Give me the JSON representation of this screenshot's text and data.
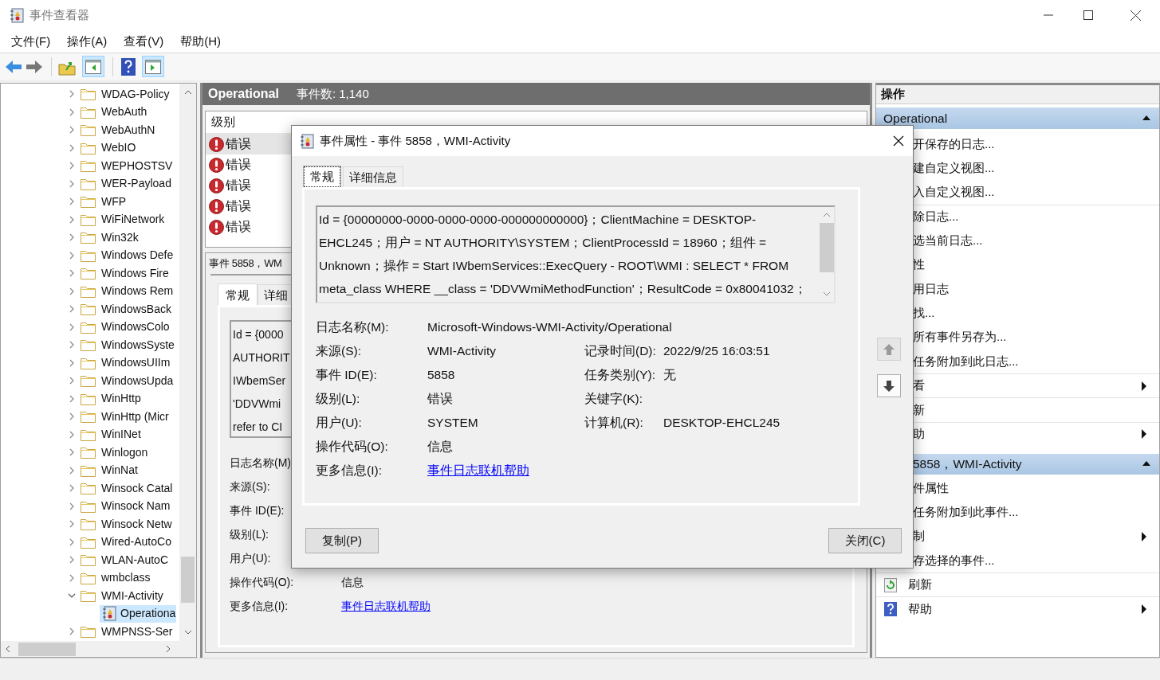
{
  "window": {
    "title": "事件查看器"
  },
  "menu": [
    "文件(F)",
    "操作(A)",
    "查看(V)",
    "帮助(H)"
  ],
  "tree": [
    {
      "label": "WDAG-Policy",
      "expanded": false,
      "selected": false
    },
    {
      "label": "WebAuth",
      "expanded": false,
      "selected": false
    },
    {
      "label": "WebAuthN",
      "expanded": false,
      "selected": false
    },
    {
      "label": "WebIO",
      "expanded": false,
      "selected": false
    },
    {
      "label": "WEPHOSTSV",
      "expanded": false,
      "selected": false
    },
    {
      "label": "WER-Payload",
      "expanded": false,
      "selected": false
    },
    {
      "label": "WFP",
      "expanded": false,
      "selected": false
    },
    {
      "label": "WiFiNetwork",
      "expanded": false,
      "selected": false
    },
    {
      "label": "Win32k",
      "expanded": false,
      "selected": false
    },
    {
      "label": "Windows Defe",
      "expanded": false,
      "selected": false
    },
    {
      "label": "Windows Fire",
      "expanded": false,
      "selected": false
    },
    {
      "label": "Windows Rem",
      "expanded": false,
      "selected": false
    },
    {
      "label": "WindowsBack",
      "expanded": false,
      "selected": false
    },
    {
      "label": "WindowsColo",
      "expanded": false,
      "selected": false
    },
    {
      "label": "WindowsSyste",
      "expanded": false,
      "selected": false
    },
    {
      "label": "WindowsUIIm",
      "expanded": false,
      "selected": false
    },
    {
      "label": "WindowsUpda",
      "expanded": false,
      "selected": false
    },
    {
      "label": "WinHttp",
      "expanded": false,
      "selected": false
    },
    {
      "label": "WinHttp (Micr",
      "expanded": false,
      "selected": false
    },
    {
      "label": "WinINet",
      "expanded": false,
      "selected": false
    },
    {
      "label": "Winlogon",
      "expanded": false,
      "selected": false
    },
    {
      "label": "WinNat",
      "expanded": false,
      "selected": false
    },
    {
      "label": "Winsock Catal",
      "expanded": false,
      "selected": false
    },
    {
      "label": "Winsock Nam",
      "expanded": false,
      "selected": false
    },
    {
      "label": "Winsock Netw",
      "expanded": false,
      "selected": false
    },
    {
      "label": "Wired-AutoCo",
      "expanded": false,
      "selected": false
    },
    {
      "label": "WLAN-AutoC",
      "expanded": false,
      "selected": false
    },
    {
      "label": "wmbclass",
      "expanded": false,
      "selected": false
    },
    {
      "label": "WMI-Activity",
      "expanded": true,
      "selected": false,
      "children": [
        {
          "label": "Operationa",
          "selected": true
        }
      ]
    },
    {
      "label": "WMPNSS-Ser",
      "expanded": false,
      "selected": false
    }
  ],
  "log": {
    "title": "Operational",
    "count": "事件数: 1,140",
    "column": "级别",
    "rows": [
      {
        "level": "错误",
        "selected": true
      },
      {
        "level": "错误",
        "selected": false
      },
      {
        "level": "错误",
        "selected": false
      },
      {
        "level": "错误",
        "selected": false
      },
      {
        "level": "错误",
        "selected": false
      }
    ]
  },
  "preview": {
    "title": "事件 5858，WM",
    "tabs": [
      {
        "label": "常规",
        "selected": true
      },
      {
        "label": "详细",
        "selected": false
      }
    ],
    "lines": [
      "Id = {0000",
      "AUTHORIT",
      "IWbemSer",
      "'DDVWmi",
      "refer to CI"
    ],
    "fields": [
      {
        "label": "日志名称(M)"
      },
      {
        "label": "来源(S):"
      },
      {
        "label": "事件 ID(E):"
      },
      {
        "label": "级别(L):"
      },
      {
        "label": "用户(U):"
      },
      {
        "label": "操作代码(O):",
        "value": "信息"
      },
      {
        "label": "更多信息(I):",
        "value": "事件日志联机帮助",
        "kind": "link"
      }
    ]
  },
  "dialog": {
    "title": "事件属性 - 事件 5858，WMI-Activity",
    "tabs": [
      {
        "label": "常规",
        "selected": true
      },
      {
        "label": "详细信息",
        "selected": false
      }
    ],
    "lines": [
      "Id = {00000000-0000-0000-0000-000000000000}；ClientMachine = DESKTOP-",
      "EHCL245；用户 = NT AUTHORITY\\SYSTEM；ClientProcessId = 18960；组件 =",
      "Unknown；操作 = Start IWbemServices::ExecQuery - ROOT\\WMI : SELECT * FROM",
      "meta_class WHERE __class = 'DDVWmiMethodFunction'；ResultCode = 0x80041032；"
    ],
    "rows": [
      {
        "cells": [
          {
            "label": "日志名称(M):",
            "value": "Microsoft-Windows-WMI-Activity/Operational"
          }
        ]
      },
      {
        "cells": [
          {
            "label": "来源(S):",
            "value": "WMI-Activity"
          },
          {
            "label": "记录时间(D):",
            "value": "2022/9/25 16:03:51"
          }
        ]
      },
      {
        "cells": [
          {
            "label": "事件 ID(E):",
            "value": "5858"
          },
          {
            "label": "任务类别(Y):",
            "value": "无"
          }
        ]
      },
      {
        "cells": [
          {
            "label": "级别(L):",
            "value": "错误"
          },
          {
            "label": "关键字(K):"
          }
        ]
      },
      {
        "cells": [
          {
            "label": "用户(U):",
            "value": "SYSTEM"
          },
          {
            "label": "计算机(R):",
            "value": "DESKTOP-EHCL245"
          }
        ]
      },
      {
        "cells": [
          {
            "label": "操作代码(O):",
            "value": "信息"
          }
        ]
      },
      {
        "cells": [
          {
            "label": "更多信息(I):",
            "value": "事件日志联机帮助",
            "kind": "link"
          }
        ]
      }
    ],
    "buttons": [
      "复制(P)",
      "关闭(C)"
    ]
  },
  "actions": {
    "title": "操作",
    "sections": [
      {
        "title": "Operational",
        "expanded": true,
        "items": [
          {
            "label": "开保存的日志...",
            "submenu": false,
            "divider": false
          },
          {
            "label": "建自定义视图...",
            "submenu": false,
            "divider": false
          },
          {
            "label": "入自定义视图...",
            "submenu": false,
            "divider": false
          },
          {
            "label": "除日志...",
            "submenu": false,
            "divider": true
          },
          {
            "label": "选当前日志...",
            "submenu": false,
            "divider": false
          },
          {
            "label": "性",
            "submenu": false,
            "divider": false
          },
          {
            "label": "用日志",
            "submenu": false,
            "divider": false
          },
          {
            "label": "找...",
            "submenu": false,
            "divider": false
          },
          {
            "label": "所有事件另存为...",
            "submenu": false,
            "divider": false
          },
          {
            "label": "任务附加到此日志...",
            "submenu": false,
            "divider": false
          },
          {
            "label": "看",
            "submenu": true,
            "divider": true
          },
          {
            "label": "新",
            "submenu": false,
            "divider": true
          },
          {
            "label": "助",
            "submenu": true,
            "divider": true
          }
        ]
      },
      {
        "title": "5858，WMI-Activity",
        "expanded": true,
        "items": [
          {
            "label": "件属性",
            "submenu": false,
            "divider": false
          },
          {
            "label": "任务附加到此事件...",
            "submenu": false,
            "divider": false
          },
          {
            "label": "制",
            "submenu": true,
            "divider": false
          },
          {
            "label": "存选择的事件...",
            "submenu": false,
            "divider": false
          }
        ]
      }
    ],
    "items": [
      {
        "label": "刷新",
        "submenu": false,
        "divider": true
      },
      {
        "label": "帮助",
        "submenu": true,
        "divider": true
      }
    ]
  }
}
